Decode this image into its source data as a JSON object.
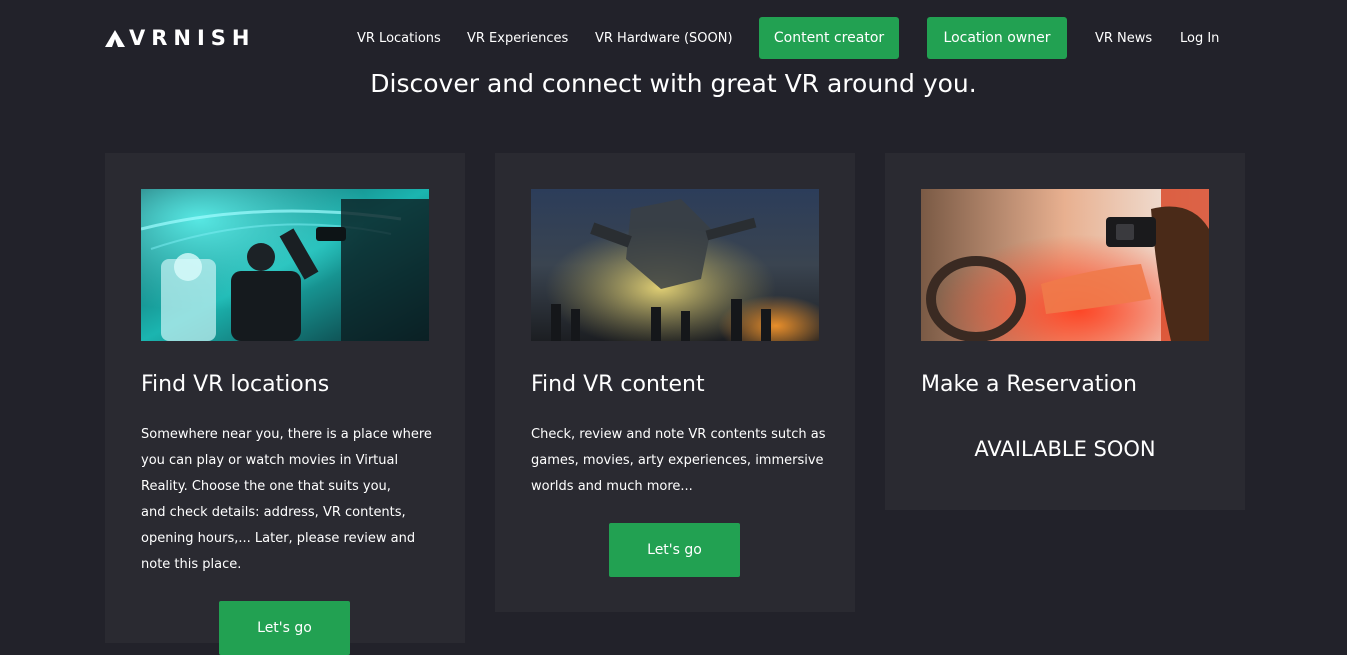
{
  "header": {
    "logo": "VRNISH",
    "nav": {
      "vr_locations": "VR Locations",
      "vr_experiences": "VR Experiences",
      "vr_hardware": "VR Hardware (SOON)",
      "content_creator": "Content creator",
      "location_owner": "Location owner",
      "vr_news": "VR News",
      "log_in": "Log In"
    }
  },
  "headline": "Discover and connect with great VR around you.",
  "cards": [
    {
      "title": "Find VR locations",
      "lines": [
        "Somewhere near you, there is a place where",
        "you can play or watch movies in Virtual",
        "Reality. Choose the one that suits you,",
        "and check details: address, VR contents,",
        "opening hours,... Later, please review and",
        "note this place."
      ],
      "button": "Let's go"
    },
    {
      "title": "Find VR content",
      "lines": [
        "Check, review and note VR contents sutch as",
        "games, movies, arty experiences, immersive",
        "worlds and much more..."
      ],
      "button": "Let's go"
    },
    {
      "title": "Make a Reservation",
      "status": "AVAILABLE SOON"
    }
  ],
  "colors": {
    "background": "#22222a",
    "card": "#2a2a31",
    "accent_green": "#22a152"
  }
}
